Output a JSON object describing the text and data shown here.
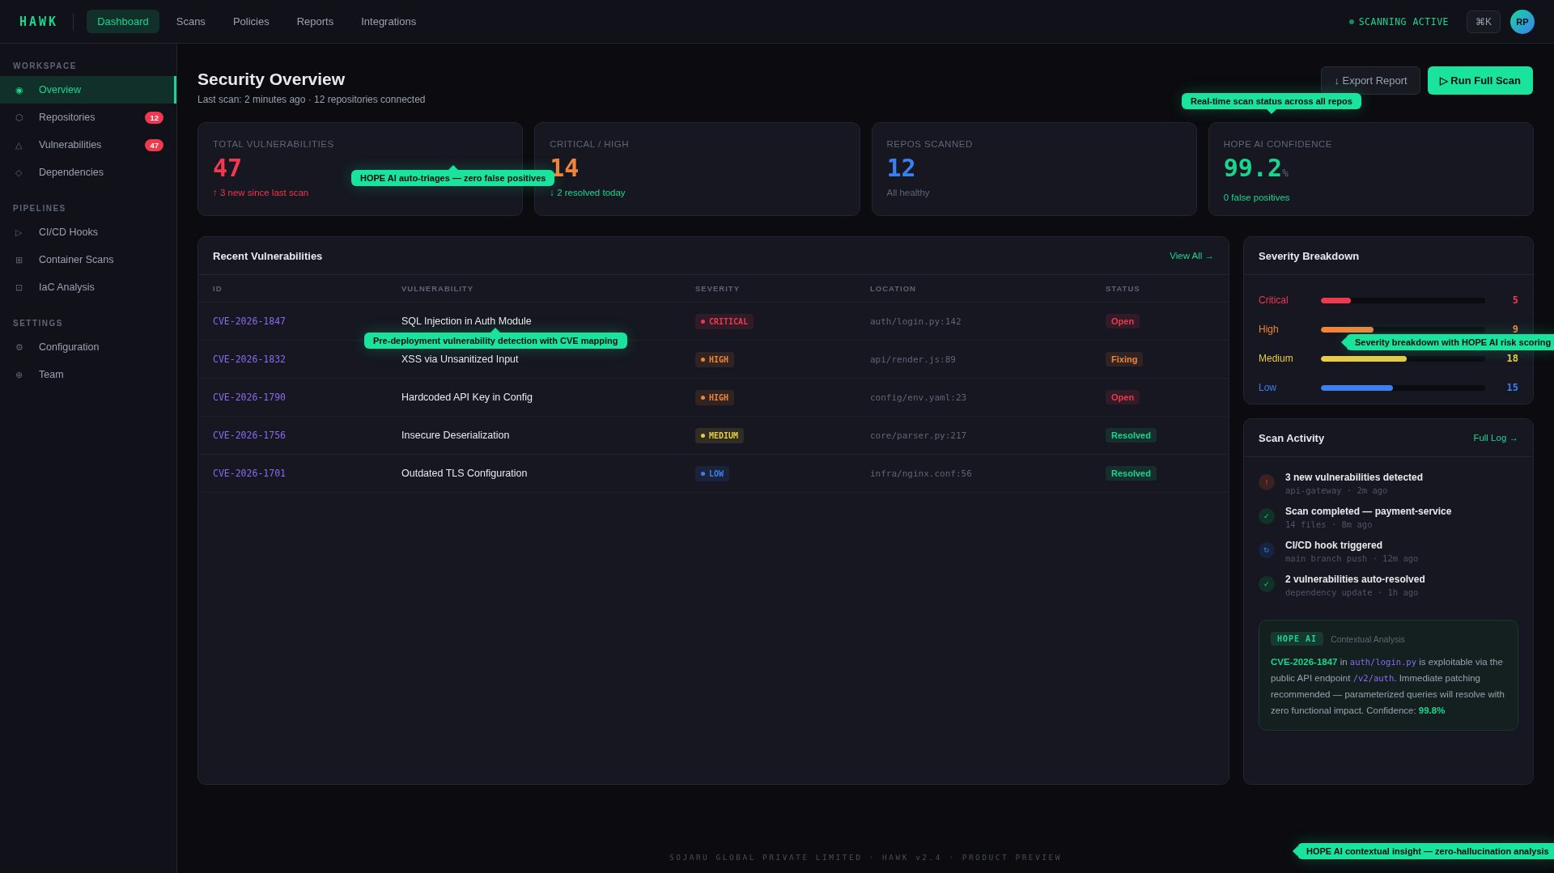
{
  "topbar": {
    "logo": "HAWK",
    "nav": [
      {
        "label": "Dashboard",
        "selected": true
      },
      {
        "label": "Scans",
        "selected": false
      },
      {
        "label": "Policies",
        "selected": false
      },
      {
        "label": "Reports",
        "selected": false
      },
      {
        "label": "Integrations",
        "selected": false
      }
    ],
    "status": "SCANNING ACTIVE",
    "shortcut": "⌘K",
    "avatar": "RP"
  },
  "sidebar": {
    "sections": [
      {
        "title": "WORKSPACE",
        "items": [
          {
            "icon": "◉",
            "label": "Overview",
            "selected": true
          },
          {
            "icon": "⬡",
            "label": "Repositories",
            "selected": false,
            "badge": "12"
          },
          {
            "icon": "△",
            "label": "Vulnerabilities",
            "selected": false,
            "badge": "47"
          },
          {
            "icon": "◇",
            "label": "Dependencies",
            "selected": false
          }
        ]
      },
      {
        "title": "PIPELINES",
        "items": [
          {
            "icon": "▷",
            "label": "CI/CD Hooks",
            "selected": false
          },
          {
            "icon": "⊞",
            "label": "Container Scans",
            "selected": false
          },
          {
            "icon": "⊡",
            "label": "IaC Analysis",
            "selected": false
          }
        ]
      },
      {
        "title": "SETTINGS",
        "items": [
          {
            "icon": "⚙",
            "label": "Configuration",
            "selected": false
          },
          {
            "icon": "⊕",
            "label": "Team",
            "selected": false
          }
        ]
      }
    ]
  },
  "header": {
    "title": "Security Overview",
    "subtitle": "Last scan: 2 minutes ago · 12 repositories connected",
    "buttons": [
      {
        "label": "↓ Export Report",
        "kind": "secondary"
      },
      {
        "label": "▷ Run Full Scan",
        "kind": "primary"
      }
    ]
  },
  "stats": [
    {
      "label": "TOTAL VULNERABILITIES",
      "value": {
        "text": "47",
        "color": "#f0384f"
      },
      "note": {
        "text": "↑ 3 new since last scan",
        "color": "#f0384f"
      }
    },
    {
      "label": "CRITICAL / HIGH",
      "value": {
        "text": "14",
        "color": "#f2843a"
      },
      "note": {
        "text": "↓ 2 resolved today",
        "color": "#19d68f"
      }
    },
    {
      "label": "REPOS SCANNED",
      "value": {
        "text": "12",
        "color": "#3b7ff0"
      },
      "note": {
        "text": "All healthy",
        "color": "#5f6577"
      }
    },
    {
      "label": "HOPE AI CONFIDENCE",
      "value": {
        "text": "99.2",
        "color": "#19d68f"
      },
      "unit": "%",
      "note": {
        "text": "0 false positives",
        "color": "#19d68f"
      }
    }
  ],
  "vulnerabilities": {
    "title": "Recent Vulnerabilities",
    "link": "View All →",
    "columns": [
      "ID",
      "VULNERABILITY",
      "SEVERITY",
      "LOCATION",
      "STATUS"
    ],
    "rows": [
      {
        "id": "CVE-2026-1847",
        "name": "SQL Injection in Auth Module",
        "severity": {
          "label": "CRITICAL",
          "color": "#f0384f"
        },
        "location": "auth/login.py:142",
        "status": {
          "label": "Open",
          "color": "#f0384f"
        }
      },
      {
        "id": "CVE-2026-1832",
        "name": "XSS via Unsanitized Input",
        "severity": {
          "label": "HIGH",
          "color": "#f2843a"
        },
        "location": "api/render.js:89",
        "status": {
          "label": "Fixing",
          "color": "#f2843a"
        }
      },
      {
        "id": "CVE-2026-1790",
        "name": "Hardcoded API Key in Config",
        "severity": {
          "label": "HIGH",
          "color": "#f2843a"
        },
        "location": "config/env.yaml:23",
        "status": {
          "label": "Open",
          "color": "#f0384f"
        }
      },
      {
        "id": "CVE-2026-1756",
        "name": "Insecure Deserialization",
        "severity": {
          "label": "MEDIUM",
          "color": "#e8cc45"
        },
        "location": "core/parser.py:217",
        "status": {
          "label": "Resolved",
          "color": "#19d68f"
        }
      },
      {
        "id": "CVE-2026-1701",
        "name": "Outdated TLS Configuration",
        "severity": {
          "label": "LOW",
          "color": "#3b7ff0"
        },
        "location": "infra/nginx.conf:56",
        "status": {
          "label": "Resolved",
          "color": "#19d68f"
        }
      }
    ]
  },
  "severity_breakdown": {
    "title": "Severity Breakdown",
    "items": [
      {
        "label": "Critical",
        "count": "5",
        "level": 0.18,
        "color": "#f0384f"
      },
      {
        "label": "High",
        "count": "9",
        "level": 0.32,
        "color": "#f2843a"
      },
      {
        "label": "Medium",
        "count": "18",
        "level": 0.52,
        "color": "#e8cc45"
      },
      {
        "label": "Low",
        "count": "15",
        "level": 0.44,
        "color": "#3b7ff0"
      }
    ]
  },
  "scan_activity": {
    "title": "Scan Activity",
    "link": "Full Log →",
    "items": [
      {
        "icon": "!",
        "kind": "alert",
        "title": "3 new vulnerabilities detected",
        "meta": "api-gateway · 2m ago"
      },
      {
        "icon": "✓",
        "kind": "success",
        "title": "Scan completed — payment-service",
        "meta": "14 files · 8m ago"
      },
      {
        "icon": "↻",
        "kind": "info",
        "title": "CI/CD hook triggered",
        "meta": "main branch push · 12m ago"
      },
      {
        "icon": "✓",
        "kind": "success",
        "title": "2 vulnerabilities auto-resolved",
        "meta": "dependency update · 1h ago"
      }
    ],
    "insight": {
      "tag": "HOPE AI",
      "subtitle": "Contextual Analysis",
      "segments": [
        {
          "text": "CVE-2026-1847",
          "kind": "id"
        },
        {
          "text": " in ",
          "kind": "plain"
        },
        {
          "text": "auth/login.py",
          "kind": "code"
        },
        {
          "text": " is exploitable via the public API endpoint ",
          "kind": "plain"
        },
        {
          "text": "/v2/auth",
          "kind": "code"
        },
        {
          "text": ". Immediate patching recommended — parameterized queries will resolve with zero functional impact. Confidence: ",
          "kind": "plain"
        },
        {
          "text": "99.8%",
          "kind": "id"
        }
      ]
    }
  },
  "footer": "SOJARU GLOBAL PRIVATE LIMITED · HAWK v2.4 · PRODUCT PREVIEW",
  "callouts": [
    {
      "text": "HOPE AI auto-triages — zero false positives",
      "kind": "up"
    },
    {
      "text": "Real-time scan status across all repos",
      "kind": "down"
    },
    {
      "text": "Pre-deployment vulnerability detection with CVE mapping",
      "kind": "up"
    },
    {
      "text": "Severity breakdown with HOPE AI risk scoring",
      "kind": "left"
    },
    {
      "text": "HOPE AI contextual insight — zero-hallucination analysis",
      "kind": "left"
    }
  ]
}
